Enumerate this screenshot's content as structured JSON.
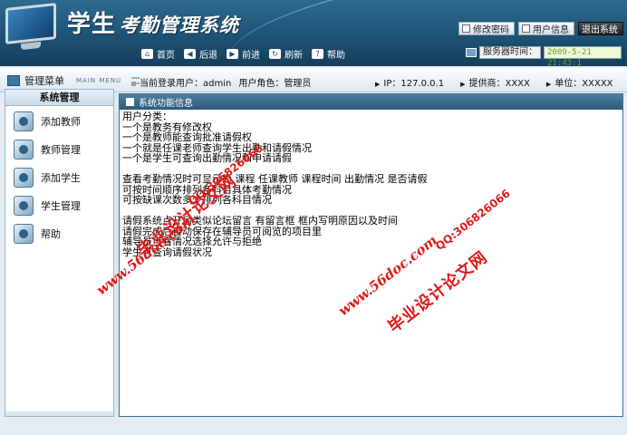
{
  "header": {
    "title_part1": "学生",
    "title_part2": "考勤管理系统",
    "actions": [
      {
        "label": "修改密码"
      },
      {
        "label": "用户信息"
      },
      {
        "label": "退出系统"
      }
    ]
  },
  "nav": {
    "items": [
      {
        "label": "首页",
        "icon": "home-icon",
        "glyph": "⌂"
      },
      {
        "label": "后退",
        "icon": "back-arrow-icon",
        "glyph": "◀"
      },
      {
        "label": "前进",
        "icon": "forward-arrow-icon",
        "glyph": "▶"
      },
      {
        "label": "刷新",
        "icon": "refresh-icon",
        "glyph": "↻"
      },
      {
        "label": "帮助",
        "icon": "help-icon",
        "glyph": "?"
      }
    ],
    "server_label": "服务器时间：",
    "server_time": "2009-5-21 21:43:1"
  },
  "infobar": {
    "menu_cn": "管理菜单",
    "menu_en": "MAIN MENU",
    "user_label": "当前登录用户：admin",
    "role_label": "用户角色：管理员",
    "ip": "IP：127.0.0.1",
    "provider": "提供商：XXXX",
    "unit": "单位：XXXXX"
  },
  "sidebar": {
    "title": "系统管理",
    "items": [
      {
        "label": "添加教师"
      },
      {
        "label": "教师管理"
      },
      {
        "label": "添加学生"
      },
      {
        "label": "学生管理"
      },
      {
        "label": "帮助"
      }
    ]
  },
  "main": {
    "panel_title": "系统功能信息",
    "lines": [
      "用户分类：",
      "一个是教务有修改权",
      "一个是教师能查询批准请假权",
      "一个就是任课老师查询学生出勤和请假情况",
      "一个是学生可查询出勤情况和申请请假",
      "",
      "查看考勤情况时可显示为   课程 任课教师 课程时间 出勤情况 是否请假",
      "可按时间顺序排列各科目具体考勤情况",
      "可按缺课次数多少排列各科目情况",
      "",
      "请假系统点开后类似论坛留言 有留言框 框内写明原因以及时间",
      "请假完成后自动保存在辅导员可阅览的项目里",
      "辅导员可看情况选择允许与拒绝",
      "学生可查询请假状况"
    ]
  },
  "watermarks": {
    "url": "www.56doc.com",
    "qq": "QQ:306826066",
    "name": "毕业设计论文网"
  },
  "colors": {
    "header_bg": "#1d5274",
    "panel_head": "#2c5a79",
    "watermark": "#e01a1a",
    "time_text": "#6a9c2a"
  }
}
